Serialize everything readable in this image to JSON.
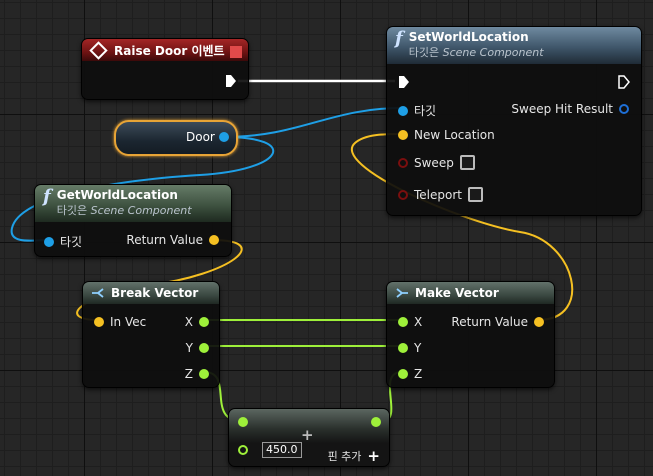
{
  "event_node": {
    "title": "Raise Door 이벤트"
  },
  "set_node": {
    "title": "SetWorldLocation",
    "target_prefix": "타깃은",
    "target_comp": "Scene Component",
    "pin_target": "타깃",
    "pin_new_location": "New Location",
    "pin_sweep": "Sweep",
    "pin_teleport": "Teleport",
    "pin_sweep_hit": "Sweep Hit Result"
  },
  "door_node": {
    "label": "Door"
  },
  "get_node": {
    "title": "GetWorldLocation",
    "target_prefix": "타깃은",
    "target_comp": "Scene Component",
    "pin_target": "타깃",
    "pin_return": "Return Value"
  },
  "break_node": {
    "title": "Break Vector",
    "pin_in": "In Vec",
    "pin_x": "X",
    "pin_y": "Y",
    "pin_z": "Z"
  },
  "make_node": {
    "title": "Make Vector",
    "pin_x": "X",
    "pin_y": "Y",
    "pin_z": "Z",
    "pin_return": "Return Value"
  },
  "add_node": {
    "value": "450.0",
    "add_pin_label": "핀 추가"
  },
  "colors": {
    "exec": "#ffffff",
    "object": "#1e9fe6",
    "vector": "#f5c022",
    "float": "#9ef03a",
    "bool": "#7a0e0e",
    "door_border": "#e8a436"
  },
  "icons": {
    "function": "function-icon",
    "event": "event-diamond-icon",
    "delegate": "delegate-pin-icon",
    "break": "break-struct-icon",
    "make": "make-struct-icon"
  }
}
